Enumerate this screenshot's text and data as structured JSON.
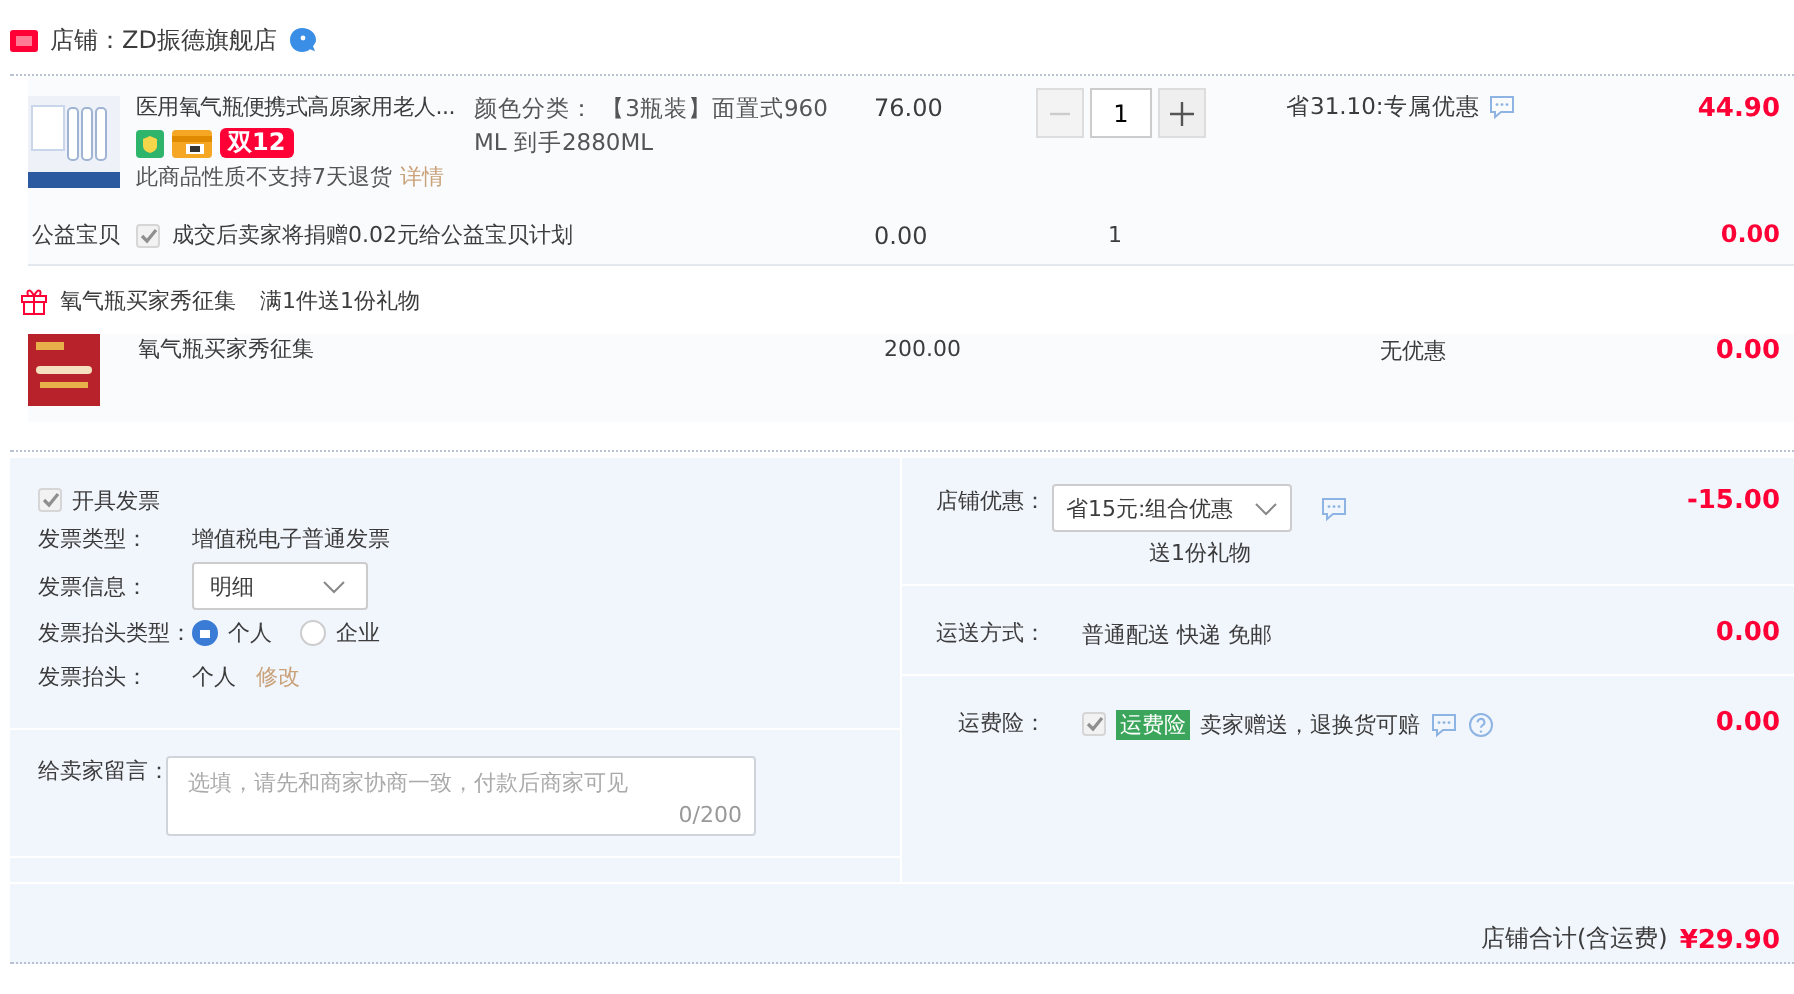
{
  "shop": {
    "label": "店铺：ZD振德旗舰店"
  },
  "item": {
    "title": "医用氧气瓶便携式高原家用老人...",
    "badges": [
      {
        "kind": "shield"
      },
      {
        "kind": "wallet"
      },
      {
        "kind": "label",
        "text": "双12"
      }
    ],
    "notice": "此商品性质不支持7天退货",
    "notice_link": "详情",
    "sku": "颜色分类： 【3瓶装】面置式960 ML 到手2880ML",
    "price": "76.00",
    "quantity": "1",
    "decrement_disabled": true,
    "discount": "省31.10:专属优惠",
    "total": "44.90"
  },
  "charity": {
    "label": "公益宝贝",
    "checked": true,
    "disabled": true,
    "text": "成交后卖家将捐赠0.02元给公益宝贝计划",
    "price": "0.00",
    "quantity": "1",
    "total": "0.00"
  },
  "gift": {
    "title": "氧气瓶买家秀征集",
    "condition": "满1件送1份礼物",
    "item": {
      "name": "氧气瓶买家秀征集",
      "price": "200.00",
      "discount": "无优惠",
      "total": "0.00"
    }
  },
  "invoice": {
    "checkbox": {
      "label": "开具发票",
      "checked": true,
      "disabled": true
    },
    "fields": [
      {
        "kind": "text",
        "label": "发票类型：",
        "value": "增值税电子普通发票"
      },
      {
        "kind": "select",
        "label": "发票信息：",
        "value": "明细"
      },
      {
        "kind": "radio",
        "label": "发票抬头类型：",
        "options": [
          {
            "label": "个人",
            "selected": true
          },
          {
            "label": "企业",
            "selected": false
          }
        ]
      },
      {
        "kind": "edit",
        "label": "发票抬头：",
        "value": "个人",
        "link": "修改"
      }
    ]
  },
  "message": {
    "label": "给卖家留言：",
    "placeholder": "选填，请先和商家协商一致，付款后商家可见",
    "counter": "0/200"
  },
  "summary": [
    {
      "kind": "coupon",
      "label": "店铺优惠：",
      "value": "省15元:组合优惠",
      "note": "送1份礼物",
      "amount": "-15.00"
    },
    {
      "kind": "text",
      "label": "运送方式：",
      "value": "普通配送 快递 免邮",
      "amount": "0.00"
    },
    {
      "kind": "insurance",
      "label": "运费险：",
      "checked": true,
      "disabled": true,
      "tag": "运费险",
      "value": "卖家赠送，退换货可赔",
      "amount": "0.00"
    }
  ],
  "total": {
    "label": "店铺合计(含运费)",
    "amount": "¥29.90"
  }
}
